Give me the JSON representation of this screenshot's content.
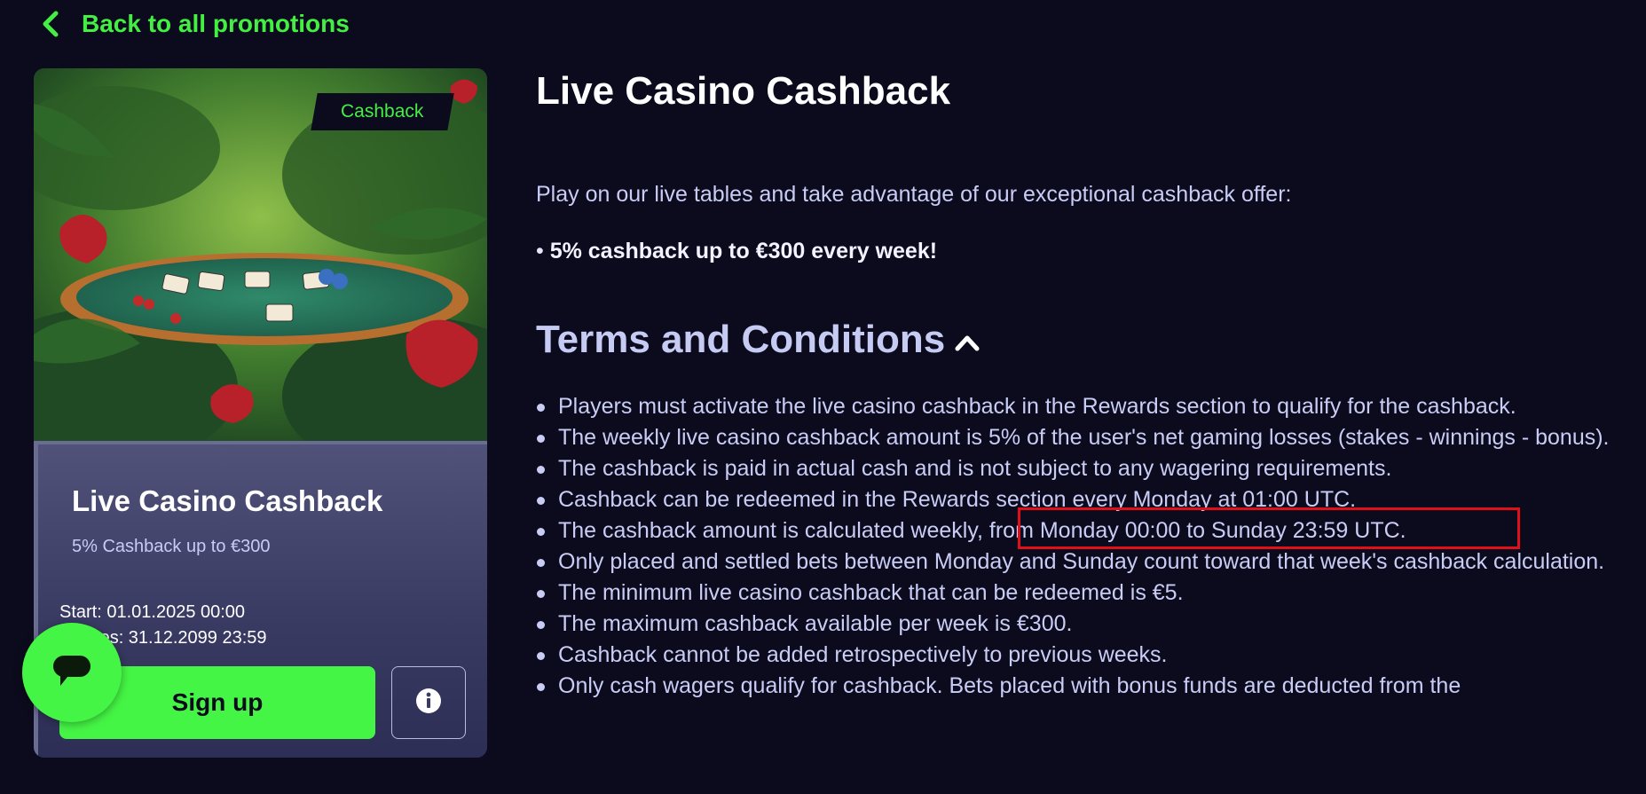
{
  "nav": {
    "back_label": "Back to all promotions"
  },
  "card": {
    "badge": "Cashback",
    "title": "Live Casino Cashback",
    "subtitle": "5% Cashback up to €300",
    "start": "Start: 01.01.2025 00:00",
    "expires": "Expires: 31.12.2099 23:59",
    "signup_label": "Sign up"
  },
  "promo": {
    "title": "Live Casino Cashback",
    "intro": "Play on our live tables and take advantage of our exceptional cashback offer:",
    "bonus": "5% cashback up to €300 every week!",
    "terms_heading": "Terms and Conditions",
    "terms": [
      "Players must activate the live casino cashback in the Rewards section to qualify for the cashback.",
      "The weekly live casino cashback amount is 5% of the user's net gaming losses (stakes - winnings - bonus).",
      "The cashback is paid in actual cash and is not subject to any wagering requirements.",
      "Cashback can be redeemed in the Rewards section every Monday at 01:00 UTC.",
      "The cashback amount is calculated weekly, from Monday 00:00 to Sunday 23:59 UTC.",
      "Only placed and settled bets between Monday and Sunday count toward that week's cashback calculation.",
      "The minimum live casino cashback that can be redeemed is €5.",
      "The maximum cashback available per week is €300.",
      "Cashback cannot be added retrospectively to previous weeks.",
      "Only cash wagers qualify for cashback. Bets placed with bonus funds are deducted from the"
    ]
  },
  "colors": {
    "accent": "#45f545",
    "background": "#0b0b1d",
    "highlight": "#e0101a"
  },
  "icons": {
    "back": "chevron-left-icon",
    "toggle": "chevron-up-icon",
    "info": "info-icon",
    "chat": "chat-icon"
  }
}
